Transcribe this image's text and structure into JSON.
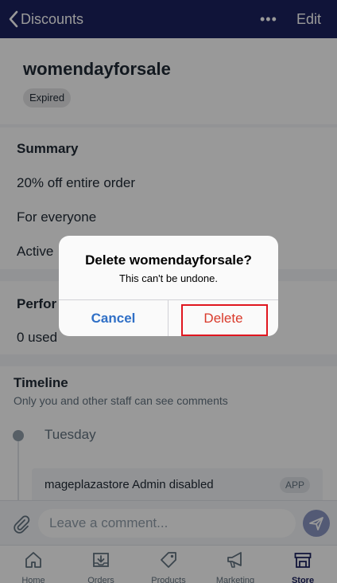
{
  "nav": {
    "back_label": "Discounts",
    "more_label": "•••",
    "edit_label": "Edit"
  },
  "discount": {
    "title": "womendayforsale",
    "status": "Expired"
  },
  "summary": {
    "heading": "Summary",
    "lines": [
      "20% off entire order",
      "For everyone",
      "Active"
    ]
  },
  "performance": {
    "heading": "Perfor",
    "used": "0 used"
  },
  "timeline": {
    "heading": "Timeline",
    "subtitle": "Only you and other staff can see comments",
    "day": "Tuesday",
    "event": "mageplazastore Admin disabled",
    "event_badge": "APP"
  },
  "composer": {
    "placeholder": "Leave a comment..."
  },
  "tabs": [
    {
      "label": "Home",
      "icon": "home-icon"
    },
    {
      "label": "Orders",
      "icon": "orders-icon"
    },
    {
      "label": "Products",
      "icon": "tag-icon"
    },
    {
      "label": "Marketing",
      "icon": "megaphone-icon"
    },
    {
      "label": "Store",
      "icon": "store-icon"
    }
  ],
  "dialog": {
    "title": "Delete womendayforsale?",
    "message": "This can't be undone.",
    "cancel_label": "Cancel",
    "delete_label": "Delete"
  },
  "colors": {
    "header": "#1c2260",
    "cancel": "#2f6fc6",
    "delete": "#d93a2b",
    "highlight_box": "#e0161f"
  }
}
